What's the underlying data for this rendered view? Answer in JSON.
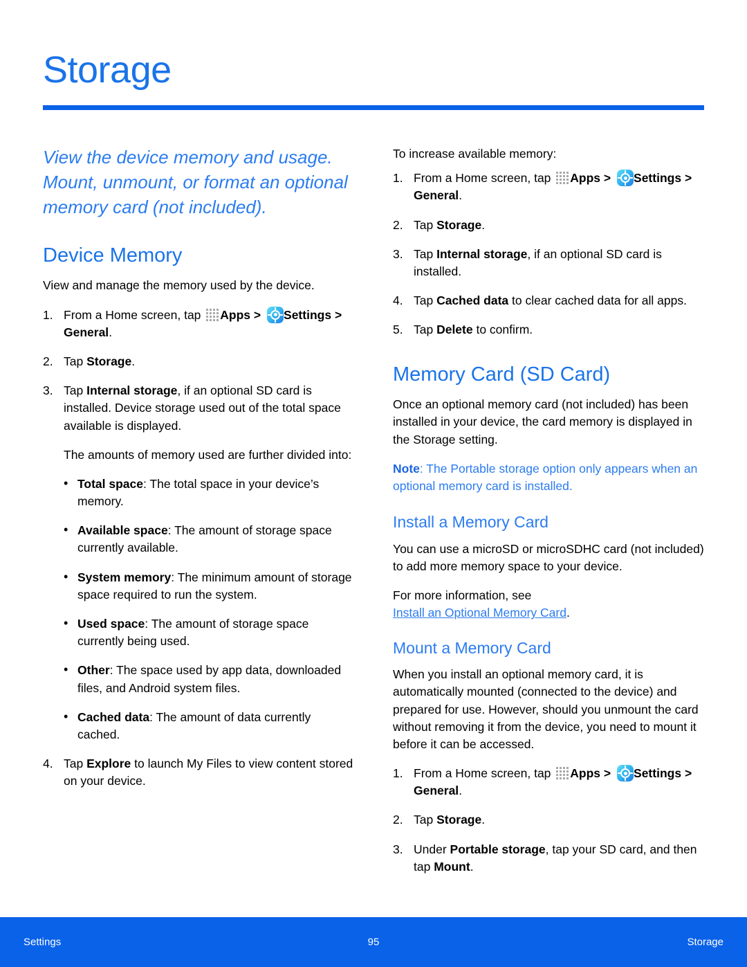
{
  "page": {
    "title": "Storage",
    "footer": {
      "left": "Settings",
      "center": "95",
      "right": "Storage"
    },
    "accent_color": "#0a62e8",
    "heading_color": "#1a73e8",
    "note_color": "#2b7cf0"
  },
  "left_column": {
    "intro": "View the device memory and usage. Mount, unmount, or format an optional memory card (not included).",
    "device_memory": {
      "heading": "Device Memory",
      "lead": "View and manage the memory used by the device.",
      "step1_pre": "From a Home screen, tap",
      "step1_apps": "Apps",
      "step1_sep": ">",
      "step1_settings": "Settings",
      "step1_tail": "> General",
      "step1_period": ".",
      "step2_pre": "Tap ",
      "step2_bold": "Storage",
      "step2_tail": ".",
      "step3_pre": "Tap ",
      "step3_bold": "Internal storage",
      "step3_tail": ", if an optional SD card is installed. Device storage used out of the total space available is displayed.",
      "step3_para": "The amounts of memory used are further divided into:",
      "bullets": [
        {
          "term": "Total space",
          "text": ": The total space in your device’s memory."
        },
        {
          "term": "Available space",
          "text": ": The amount of storage space currently available."
        },
        {
          "term": "System memory",
          "text": ": The minimum amount of storage space required to run the system."
        },
        {
          "term": "Used space",
          "text": ": The amount of storage space currently being used."
        },
        {
          "term": "Other",
          "text": ": The space used by app data, downloaded files, and Android system files."
        },
        {
          "term": "Cached data",
          "text": ": The amount of data currently cached."
        }
      ],
      "step4_pre": "Tap ",
      "step4_bold": "Explore",
      "step4_tail": " to launch My Files to view content stored on your device."
    }
  },
  "right_column": {
    "increase_memory": {
      "lead": "To increase available memory:",
      "step1_pre": "From a Home screen, tap",
      "step1_apps": "Apps",
      "step1_sep": ">",
      "step1_settings": "Settings",
      "step1_tail": "> General",
      "step1_period": ".",
      "step2_pre": "Tap ",
      "step2_bold": "Storage",
      "step2_tail": ".",
      "step3_pre": "Tap ",
      "step3_bold": "Internal storage",
      "step3_tail": ", if an optional SD card is installed.",
      "step4_pre": "Tap ",
      "step4_bold": "Cached data",
      "step4_tail": " to clear cached data for all apps.",
      "step5_pre": "Tap ",
      "step5_bold": "Delete",
      "step5_tail": " to confirm."
    },
    "memory_card": {
      "heading": "Memory Card (SD Card)",
      "lead": "Once an optional memory card (not included) has been installed in your device, the card memory is displayed in the Storage setting.",
      "note_label": "Note",
      "note_text": ": The Portable storage option only appears when an optional memory card is installed."
    },
    "install_card": {
      "heading": "Install a Memory Card",
      "body": "You can use a microSD or microSDHC card (not included) to add more memory space to your device.",
      "see_more_pre": "For more information, see",
      "link_text": "Install an Optional Memory Card",
      "link_period": "."
    },
    "mount_card": {
      "heading": "Mount a Memory Card",
      "body": "When you install an optional memory card, it is automatically mounted (connected to the device) and prepared for use. However, should you unmount the card without removing it from the device, you need to mount it before it can be accessed.",
      "step1_pre": "From a Home screen, tap",
      "step1_apps": "Apps",
      "step1_sep": ">",
      "step1_settings": "Settings",
      "step1_tail": "> General",
      "step1_period": ".",
      "step2_pre": "Tap ",
      "step2_bold": "Storage",
      "step2_tail": ".",
      "step3_pre": "Under ",
      "step3_bold": "Portable storage",
      "step3_mid": ", tap your SD card, and then tap ",
      "step3_bold2": "Mount",
      "step3_tail": "."
    }
  },
  "icons": {
    "apps": "apps-grid-icon",
    "settings": "settings-gear-icon"
  }
}
